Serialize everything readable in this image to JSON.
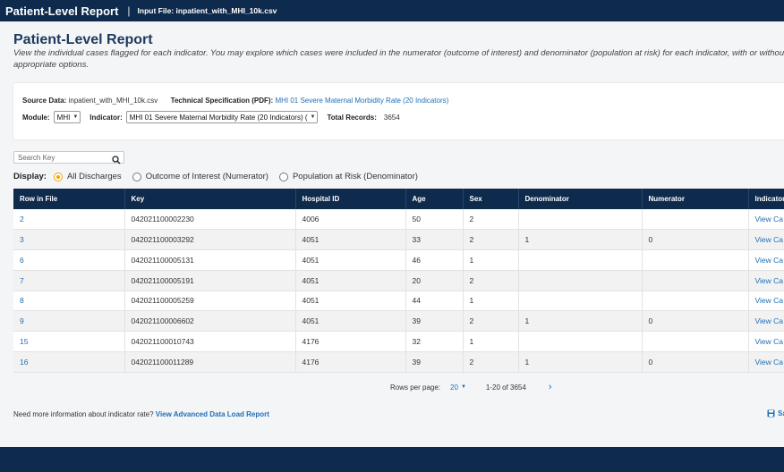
{
  "header": {
    "title": "Patient-Level Report",
    "separator": "|",
    "input_file": "Input File: inpatient_with_MHI_10k.csv"
  },
  "page": {
    "title": "Patient-Level Report",
    "description": "View the individual cases flagged for each indicator. You may explore which cases were included in the numerator (outcome of interest) and denominator (population at risk) for each indicator, with or without appropriate options."
  },
  "info": {
    "source_label": "Source Data:",
    "source_value": "inpatient_with_MHI_10k.csv",
    "spec_label": "Technical Specification (PDF):",
    "spec_link": "MHI 01 Severe Maternal Morbidity Rate (20 Indicators)",
    "module_label": "Module:",
    "module_value": "MHI",
    "indicator_label": "Indicator:",
    "indicator_value": "MHI 01 Severe Maternal Morbidity Rate (20 Indicators) (",
    "total_label": "Total Records:",
    "total_value": "3654"
  },
  "search": {
    "placeholder": "Search Key"
  },
  "display": {
    "label": "Display:",
    "options": [
      "All Discharges",
      "Outcome of Interest (Numerator)",
      "Population at Risk (Denominator)"
    ],
    "selected": 0
  },
  "table": {
    "columns": [
      "Row in File",
      "Key",
      "Hospital ID",
      "Age",
      "Sex",
      "Denominator",
      "Numerator",
      "Indicator"
    ],
    "rows": [
      [
        "2",
        "042021100002230",
        "4006",
        "50",
        "2",
        "",
        "",
        "View Ca"
      ],
      [
        "3",
        "042021100003292",
        "4051",
        "33",
        "2",
        "1",
        "0",
        "View Ca"
      ],
      [
        "6",
        "042021100005131",
        "4051",
        "46",
        "1",
        "",
        "",
        "View Ca"
      ],
      [
        "7",
        "042021100005191",
        "4051",
        "20",
        "2",
        "",
        "",
        "View Ca"
      ],
      [
        "8",
        "042021100005259",
        "4051",
        "44",
        "1",
        "",
        "",
        "View Ca"
      ],
      [
        "9",
        "042021100006602",
        "4051",
        "39",
        "2",
        "1",
        "0",
        "View Ca"
      ],
      [
        "15",
        "042021100010743",
        "4176",
        "32",
        "1",
        "",
        "",
        "View Ca"
      ],
      [
        "16",
        "042021100011289",
        "4176",
        "39",
        "2",
        "1",
        "0",
        "View Ca"
      ]
    ]
  },
  "pagination": {
    "rows_per_page_label": "Rows per page:",
    "rows_per_page_value": "20",
    "range": "1-20 of 3654",
    "next_icon": "chevron-right"
  },
  "footer": {
    "note": "Need more information about indicator rate?",
    "link": "View Advanced Data Load Report",
    "save_label": "Sa"
  },
  "colors": {
    "navy": "#0e2a4d",
    "link": "#1f6fb5",
    "radio_selected": "#f0a500"
  }
}
